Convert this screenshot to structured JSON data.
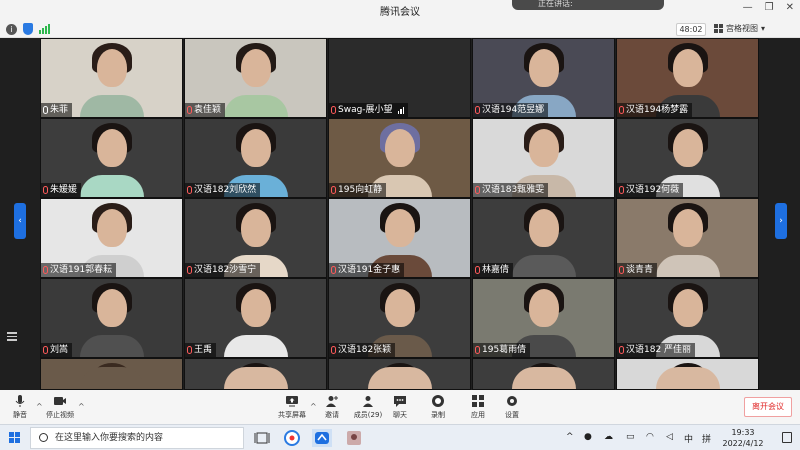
{
  "window": {
    "title": "腾讯会议",
    "notification": "正在讲话:",
    "controls": [
      "—",
      "❐",
      "✕"
    ]
  },
  "infobar": {
    "timer": "48:02",
    "view_mode": "宫格视图"
  },
  "participants": [
    {
      "name": "朱菲",
      "bg": "#d7d2c8",
      "shirt": "#9fb8a4",
      "hair": "#2a1d18"
    },
    {
      "name": "袁佳颖",
      "bg": "#c9c6be",
      "shirt": "#a8c7a2",
      "hair": "#231a16"
    },
    {
      "name": "Swag-展小望",
      "bg": "#2b2b2b",
      "shirt": "#2b2b2b",
      "hair": "#2b2b2b",
      "empty": true
    },
    {
      "name": "汉语194范昱娜",
      "bg": "#4a4a55",
      "shirt": "#88a7c4",
      "hair": "#1a1412"
    },
    {
      "name": "汉语194杨梦露",
      "bg": "#6b4a3a",
      "shirt": "#3a3a3a",
      "hair": "#1a1412"
    },
    {
      "name": "朱媛媛",
      "bg": "#3d3d3d",
      "shirt": "#a9d8c4",
      "hair": "#1a1412"
    },
    {
      "name": "汉语182刘欣然",
      "bg": "#3a3a3a",
      "shirt": "#6ab0d8",
      "hair": "#1a1412"
    },
    {
      "name": "195向虹静",
      "bg": "#6e5a45",
      "shirt": "#d9c7b2",
      "hair": "#6e6fa0"
    },
    {
      "name": "汉语183甄雅雯",
      "bg": "#d9d9d9",
      "shirt": "#c8b8a8",
      "hair": "#2a1d18"
    },
    {
      "name": "汉语192何薇",
      "bg": "#3d3d3d",
      "shirt": "#e0e0e0",
      "hair": "#1a1412"
    },
    {
      "name": "汉语191郭春耘",
      "bg": "#e6e6e6",
      "shirt": "#cfcfcf",
      "hair": "#2a1d18"
    },
    {
      "name": "汉语182沙雪宁",
      "bg": "#3d3d3d",
      "shirt": "#e6d8c8",
      "hair": "#1a1412"
    },
    {
      "name": "汉语191金子惠",
      "bg": "#b8bcc0",
      "shirt": "#6a4a3a",
      "hair": "#1a1412"
    },
    {
      "name": "林嘉倩",
      "bg": "#3d3d3d",
      "shirt": "#5a5a5a",
      "hair": "#1a1412"
    },
    {
      "name": "谈青青",
      "bg": "#8a7a6a",
      "shirt": "#cfc4b8",
      "hair": "#1a1412"
    },
    {
      "name": "刘嵩",
      "bg": "#3a3a3a",
      "shirt": "#505050",
      "hair": "#1a1412"
    },
    {
      "name": "王禹",
      "bg": "#3d3d3d",
      "shirt": "#e8e8e8",
      "hair": "#1a1412"
    },
    {
      "name": "汉语182张颖",
      "bg": "#3d3d3d",
      "shirt": "#6a5a4a",
      "hair": "#1a1412"
    },
    {
      "name": "195葛雨倩",
      "bg": "#7a7a70",
      "shirt": "#4a4a4a",
      "hair": "#1a1412"
    },
    {
      "name": "汉语182 严佳丽",
      "bg": "#3d3d3d",
      "shirt": "#d8d8d8",
      "hair": "#1a1412"
    },
    {
      "name": "",
      "bg": "#6a5a4a",
      "shirt": "#6a5a4a",
      "hair": "#3a2a20"
    },
    {
      "name": "",
      "bg": "#3d3d3d",
      "shirt": "#d8b8a0",
      "hair": "#1a1412"
    },
    {
      "name": "",
      "bg": "#3d3d3d",
      "shirt": "#d8b8a0",
      "hair": "#1a1412"
    },
    {
      "name": "",
      "bg": "#3d3d3d",
      "shirt": "#d8b8a0",
      "hair": "#1a1412"
    },
    {
      "name": "",
      "bg": "#d8d8d8",
      "shirt": "#d8b8a0",
      "hair": "#1a1412"
    }
  ],
  "toolbar": {
    "mute": "静音",
    "stop_video": "停止视频",
    "share_screen": "共享屏幕",
    "invite": "邀请",
    "members": "成员(29)",
    "chat": "聊天",
    "record": "录制",
    "apps": "应用",
    "settings": "设置",
    "leave": "离开会议"
  },
  "taskbar": {
    "search_placeholder": "在这里输入你要搜索的内容",
    "ime": "中",
    "ime2": "拼",
    "time": "19:33",
    "date": "2022/4/12"
  },
  "colors": {
    "accent": "#1e6fe0",
    "leave": "#e02828"
  }
}
